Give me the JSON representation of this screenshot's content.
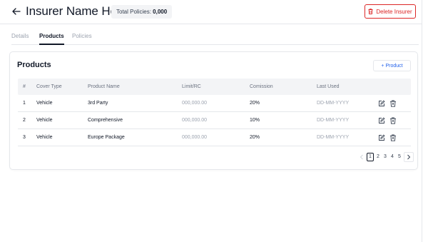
{
  "header": {
    "title": "Insurer Name Here",
    "badge_label": "Total Policies:",
    "badge_value": "0,000",
    "delete_label": "Delete Insurer"
  },
  "tabs": [
    {
      "label": "Details",
      "active": false
    },
    {
      "label": "Products",
      "active": true
    },
    {
      "label": "Policies",
      "active": false
    }
  ],
  "products": {
    "title": "Products",
    "add_label": "+ Product",
    "columns": [
      "#",
      "Cover Type",
      "Product Name",
      "Limit/RC",
      "Comission",
      "Last Used"
    ],
    "rows": [
      {
        "num": "1",
        "cover_type": "Vehicle",
        "product_name": "3rd Party",
        "limit": "000,000.00",
        "commission": "20%",
        "last_used": "DD-MM-YYYY"
      },
      {
        "num": "2",
        "cover_type": "Vehicle",
        "product_name": "Comprehensive",
        "limit": "000,000.00",
        "commission": "10%",
        "last_used": "DD-MM-YYYY"
      },
      {
        "num": "3",
        "cover_type": "Vehicle",
        "product_name": "Europe Package",
        "limit": "000,000.00",
        "commission": "20%",
        "last_used": "DD-MM-YYYY"
      }
    ],
    "row_icons": [
      "edit-icon",
      "trash-icon"
    ],
    "pagination": {
      "pages": [
        "1",
        "2",
        "3",
        "4",
        "5"
      ],
      "current": "1"
    }
  },
  "colors": {
    "accent": "#2563eb",
    "danger": "#dc2626",
    "header_bg": "#f3f4f6",
    "border": "#e5e7eb"
  }
}
